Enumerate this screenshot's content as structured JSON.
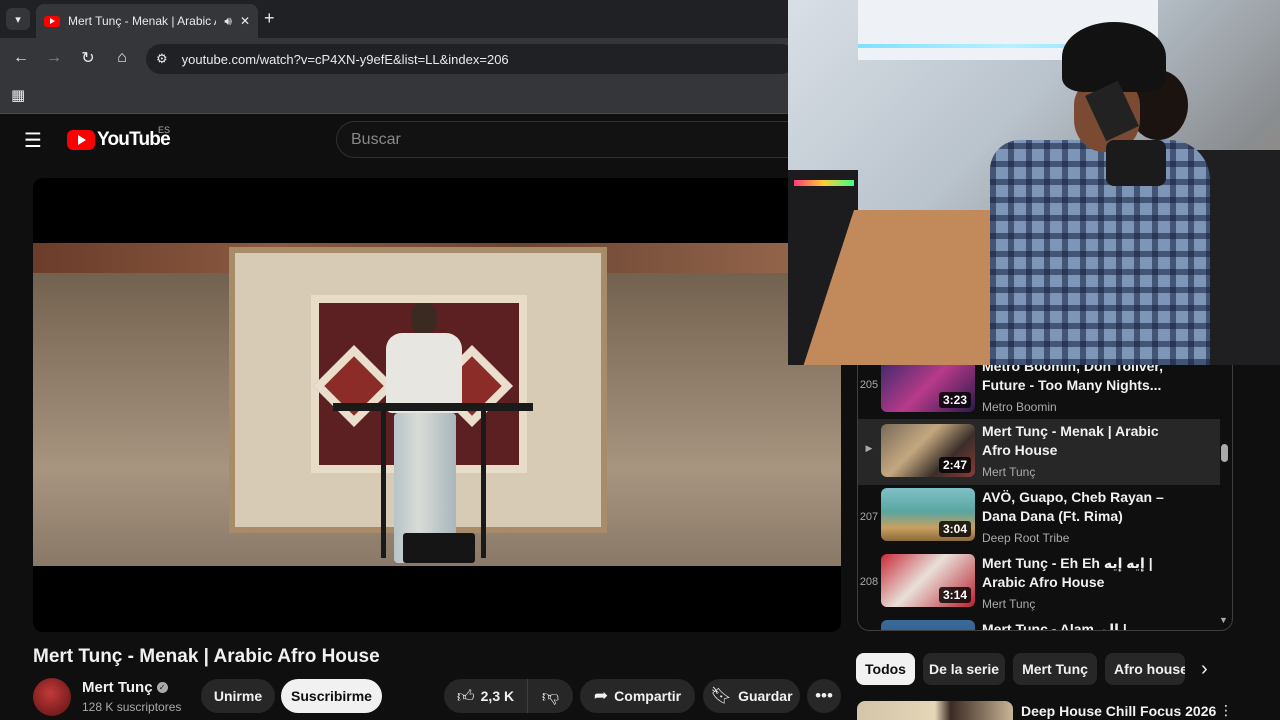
{
  "browser": {
    "tab_title": "Mert Tunç - Menak | Arabic Afro House",
    "tab_audio_icon": "speaker-icon",
    "url": "youtube.com/watch?v=cP4XN-y9efE&list=LL&index=206"
  },
  "youtube": {
    "logo_text": "YouTube",
    "country_code": "ES",
    "search_placeholder": "Buscar"
  },
  "video": {
    "title": "Mert Tunç - Menak | Arabic Afro House",
    "channel": "Mert Tunç",
    "subscribers": "128 K suscriptores",
    "join_label": "Unirme",
    "subscribe_label": "Suscribirme",
    "likes": "2,3 K",
    "share_label": "Compartir",
    "save_label": "Guardar"
  },
  "playlist": {
    "items": [
      {
        "index": "205",
        "title": "Metro Boomin, Don Toliver, Future - Too Many Nights...",
        "channel": "Metro Boomin",
        "duration": "3:23",
        "current": false
      },
      {
        "index": "▶",
        "title": "Mert Tunç - Menak | Arabic Afro House",
        "channel": "Mert Tunç",
        "duration": "2:47",
        "current": true
      },
      {
        "index": "207",
        "title": "AVÖ, Guapo, Cheb Rayan – Dana Dana (Ft. Rima) [Radio...",
        "channel": "Deep Root Tribe",
        "duration": "3:04",
        "current": false
      },
      {
        "index": "208",
        "title": "Mert Tunç - Eh Eh إيه إيه | Arabic Afro House",
        "channel": "Mert Tunç",
        "duration": "3:14",
        "current": false
      },
      {
        "index": "",
        "title": "Mert Tunç - Alam الم | Arabic",
        "channel": "",
        "duration": "",
        "current": false
      }
    ]
  },
  "chips": [
    "Todos",
    "De la serie",
    "Mert Tunç",
    "Afro house"
  ],
  "recommendation": {
    "title": "Deep House Chill Focus 2026"
  },
  "colors": {
    "background": "#0f0f0f",
    "brand_red": "#ff0000",
    "chip_active": "#f1f1f1"
  }
}
